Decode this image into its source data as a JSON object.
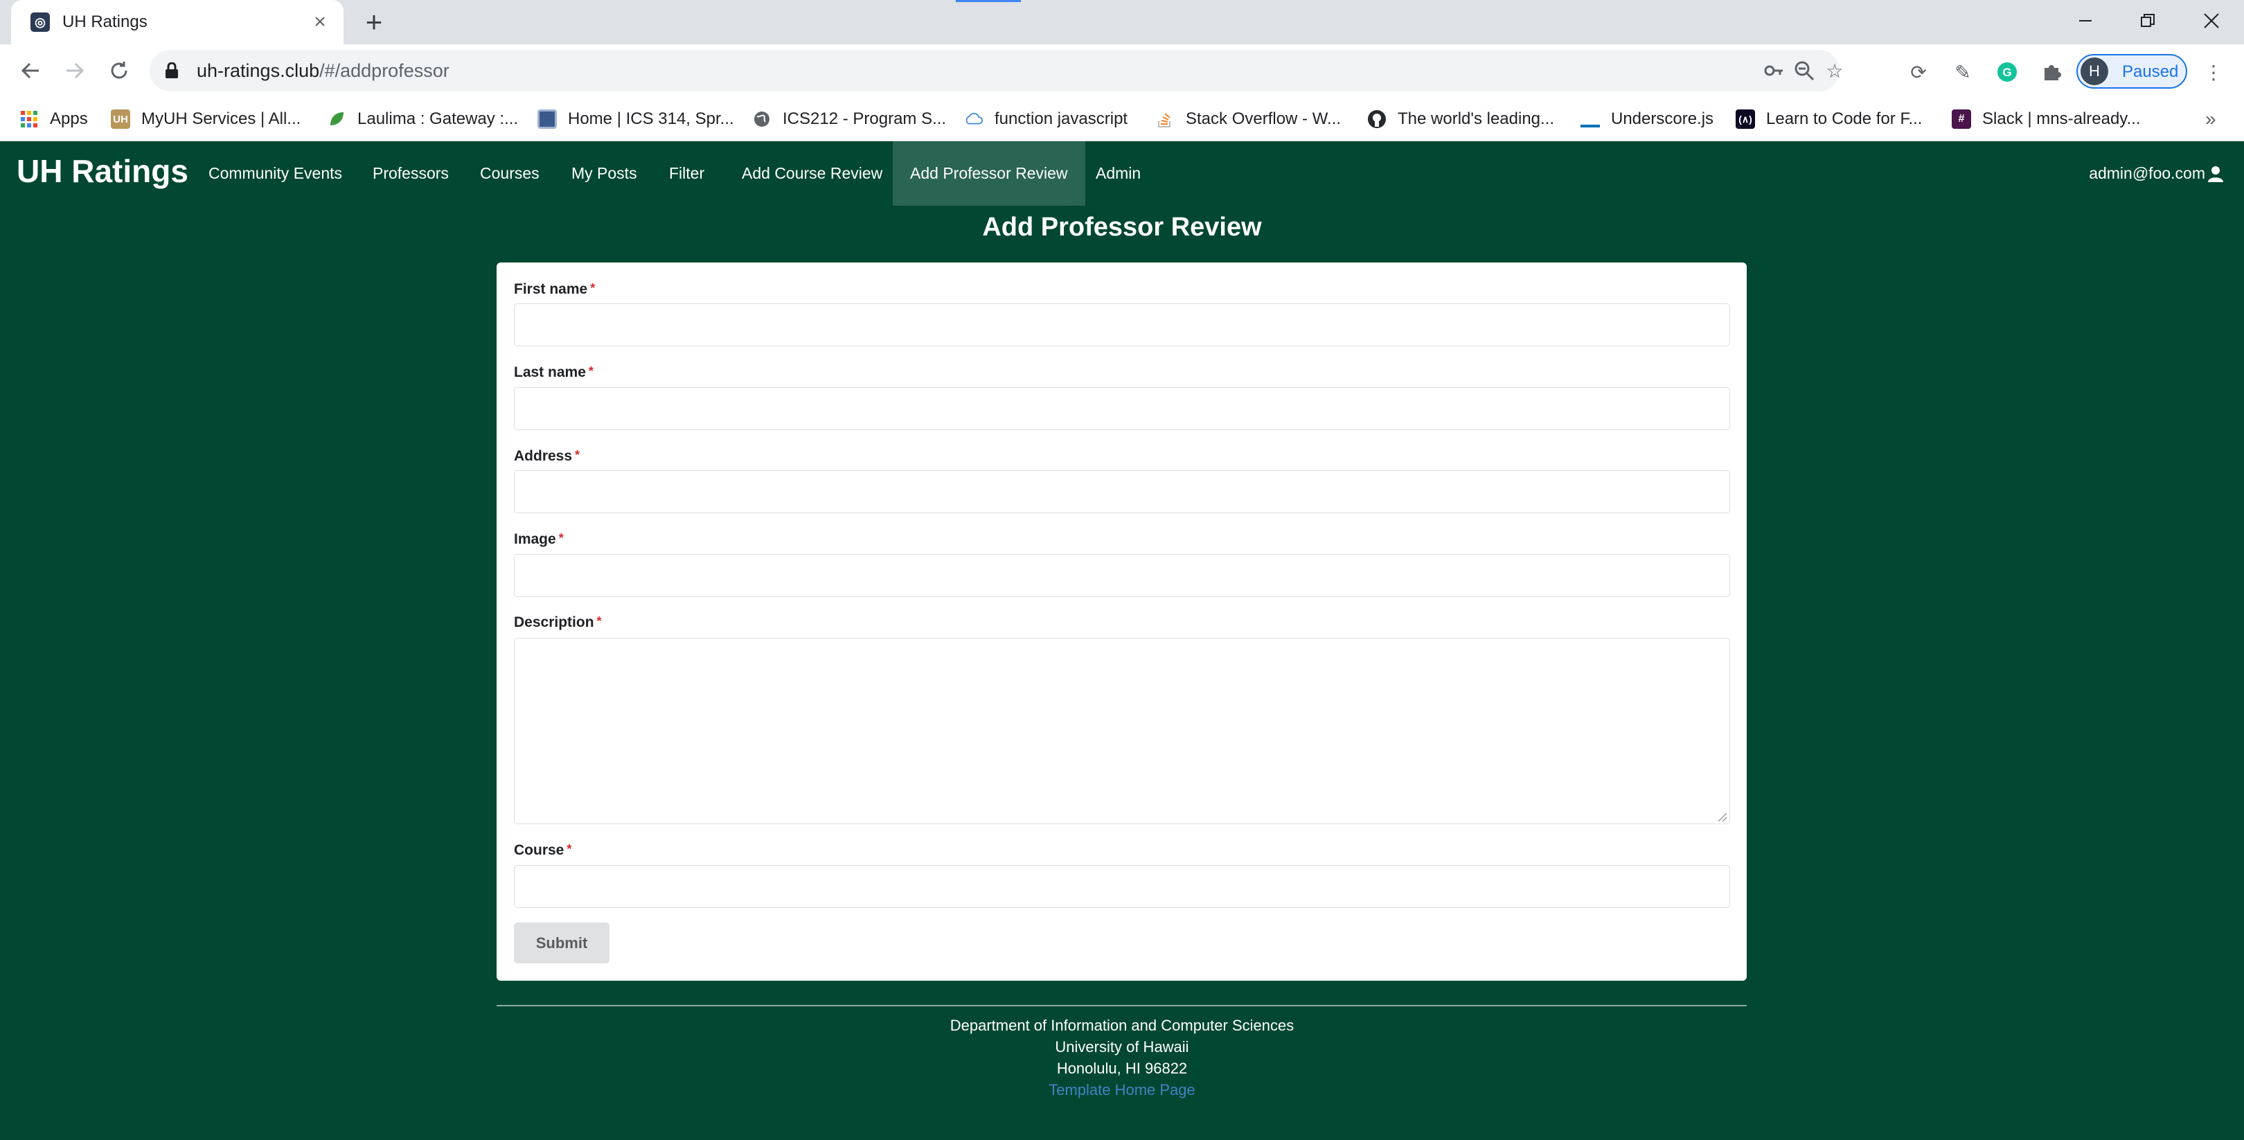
{
  "browser": {
    "tab_title": "UH Ratings",
    "url_host": "uh-ratings.club",
    "url_path": "/#/addprofessor",
    "profile_initial": "H",
    "profile_status": "Paused",
    "bookmarks": [
      {
        "label": "Apps",
        "icon": "apps-grid-icon"
      },
      {
        "label": "MyUH Services | All...",
        "icon": "uh-logo-icon"
      },
      {
        "label": "Laulima : Gateway :...",
        "icon": "leaf-icon"
      },
      {
        "label": "Home | ICS 314, Spr...",
        "icon": "square-icon"
      },
      {
        "label": "ICS212 - Program S...",
        "icon": "globe-icon"
      },
      {
        "label": "function javascript",
        "icon": "cloud-icon"
      },
      {
        "label": "Stack Overflow - W...",
        "icon": "stackoverflow-icon"
      },
      {
        "label": "The world's leading...",
        "icon": "github-icon"
      },
      {
        "label": "Underscore.js",
        "icon": "underscore-icon"
      },
      {
        "label": "Learn to Code for F...",
        "icon": "freecodecamp-icon"
      },
      {
        "label": "Slack | mns-already...",
        "icon": "slack-icon"
      }
    ]
  },
  "app": {
    "brand": "UH Ratings",
    "nav": [
      {
        "label": "Community Events",
        "active": false
      },
      {
        "label": "Professors",
        "active": false
      },
      {
        "label": "Courses",
        "active": false
      },
      {
        "label": "My Posts",
        "active": false
      },
      {
        "label": "Filter",
        "active": false
      },
      {
        "label": "Add Course Review",
        "active": false
      },
      {
        "label": "Add Professor Review",
        "active": true
      },
      {
        "label": "Admin",
        "active": false
      }
    ],
    "user_email": "admin@foo.com"
  },
  "form": {
    "title": "Add Professor Review",
    "required_marker": "*",
    "fields": {
      "first_name": {
        "label": "First name",
        "value": ""
      },
      "last_name": {
        "label": "Last name",
        "value": ""
      },
      "address": {
        "label": "Address",
        "value": ""
      },
      "image": {
        "label": "Image",
        "value": ""
      },
      "description": {
        "label": "Description",
        "value": ""
      },
      "course": {
        "label": "Course",
        "value": ""
      }
    },
    "submit_label": "Submit"
  },
  "footer": {
    "line1": "Department of Information and Computer Sciences",
    "line2": "University of Hawaii",
    "line3": "Honolulu, HI 96822",
    "link": "Template Home Page"
  },
  "colors": {
    "brand_green": "#024731",
    "required_red": "#db2828",
    "link_blue": "#4183c4"
  }
}
